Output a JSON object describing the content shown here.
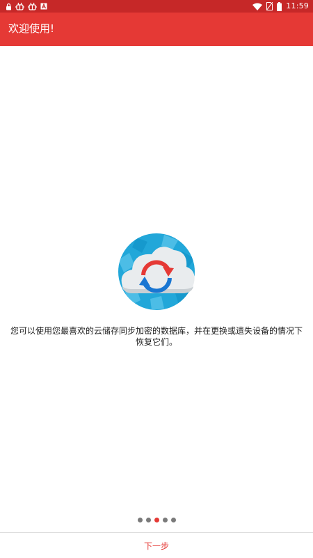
{
  "status_bar": {
    "time": "11:59",
    "left_icons": [
      "lock-icon",
      "bug-icon",
      "bug-icon",
      "font-icon"
    ],
    "right_icons": [
      "wifi-icon",
      "no-sim-icon",
      "battery-icon"
    ]
  },
  "app_bar": {
    "title": "欢迎使用!"
  },
  "main": {
    "logo_icon": "cloud-sync-icon",
    "description": "您可以使用您最喜欢的云储存同步加密的数据库，并在更换或遗失设备的情况下恢复它们。"
  },
  "pager": {
    "total": 5,
    "active_index": 2
  },
  "footer": {
    "next_label": "下一步"
  },
  "colors": {
    "status_bar": "#c62828",
    "app_bar": "#e53935",
    "accent": "#e53935",
    "dot_inactive": "#7a7a7a"
  }
}
